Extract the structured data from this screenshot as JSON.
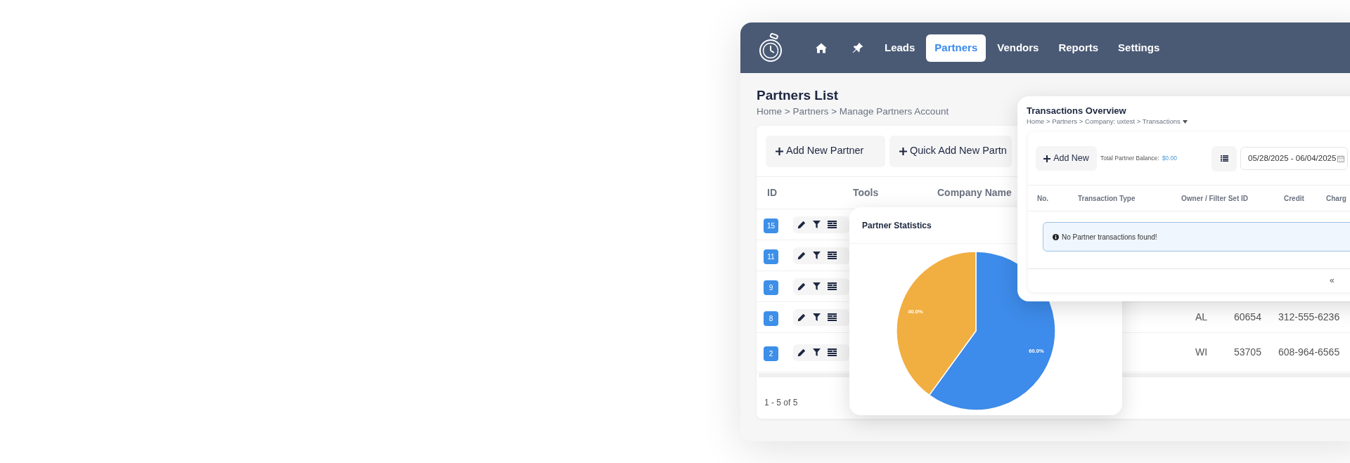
{
  "header": {
    "nav": [
      {
        "label": "Leads",
        "selected": false
      },
      {
        "label": "Partners",
        "selected": true
      },
      {
        "label": "Vendors",
        "selected": false
      },
      {
        "label": "Reports",
        "selected": false
      },
      {
        "label": "Settings",
        "selected": false
      }
    ]
  },
  "page": {
    "title": "Partners List",
    "breadcrumb": "Home > Partners > Manage Partners Account"
  },
  "toolbar_buttons": [
    "Add New Partner",
    "Quick Add New Partn"
  ],
  "table": {
    "columns": [
      "ID",
      "Tools",
      "Company Name"
    ],
    "rows": [
      {
        "id": "15"
      },
      {
        "id": "11"
      },
      {
        "id": "9"
      },
      {
        "id": "8",
        "state": "AL",
        "zip": "60654",
        "phone": "312-555-6236"
      },
      {
        "id": "2",
        "state": "WI",
        "zip": "53705",
        "phone": "608-964-6565"
      }
    ],
    "footer": "1 - 5 of 5"
  },
  "partner_statistics": {
    "title": "Partner Statistics",
    "chart_data": {
      "type": "pie",
      "values": [
        60,
        40
      ],
      "colors": [
        "#3d8bea",
        "#f1ae41"
      ],
      "value_labels": [
        "60.0%",
        "40.0%"
      ]
    }
  },
  "transactions": {
    "title": "Transactions Overview",
    "breadcrumb": "Home > Partners > Company: uxtest > Transactions",
    "add_button": "Add New",
    "balance_label": "Total Partner Balance:",
    "balance_value": "$0.00",
    "date_range": "05/28/2025 - 06/04/2025",
    "columns": [
      "No.",
      "Transaction Type",
      "Owner / Filter Set ID",
      "Credit",
      "Charg"
    ],
    "alert": "No Partner transactions found!",
    "pager": [
      "«"
    ]
  }
}
